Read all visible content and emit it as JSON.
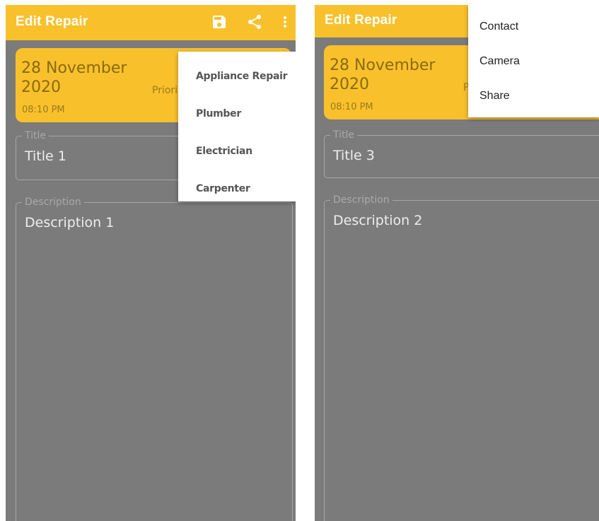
{
  "left_screen": {
    "appbar": {
      "title": "Edit Repair",
      "icons": [
        "save-icon",
        "share-icon",
        "more-vert-icon"
      ]
    },
    "date_card": {
      "date": "28 November 2020",
      "time": "08:10 PM",
      "priority_label": "Priori"
    },
    "title_field": {
      "label": "Title",
      "value": "Title 1"
    },
    "description_field": {
      "label": "Description",
      "value": "Description 1"
    },
    "category_menu": {
      "items": [
        "Appliance Repair",
        "Plumber",
        "Electrician",
        "Carpenter"
      ]
    }
  },
  "right_screen": {
    "appbar": {
      "title": "Edit Repair"
    },
    "date_card": {
      "date": "28 November 2020",
      "time": "08:10 PM",
      "priority_label": "P"
    },
    "title_field": {
      "label": "Title",
      "value": "Title 3"
    },
    "description_field": {
      "label": "Description",
      "value": "Description 2"
    },
    "overflow_menu": {
      "items": [
        "Contact",
        "Camera",
        "Share"
      ]
    }
  },
  "colors": {
    "accent": "#f8c12c",
    "background": "#7b7b7b",
    "menu_background": "#ffffff"
  }
}
